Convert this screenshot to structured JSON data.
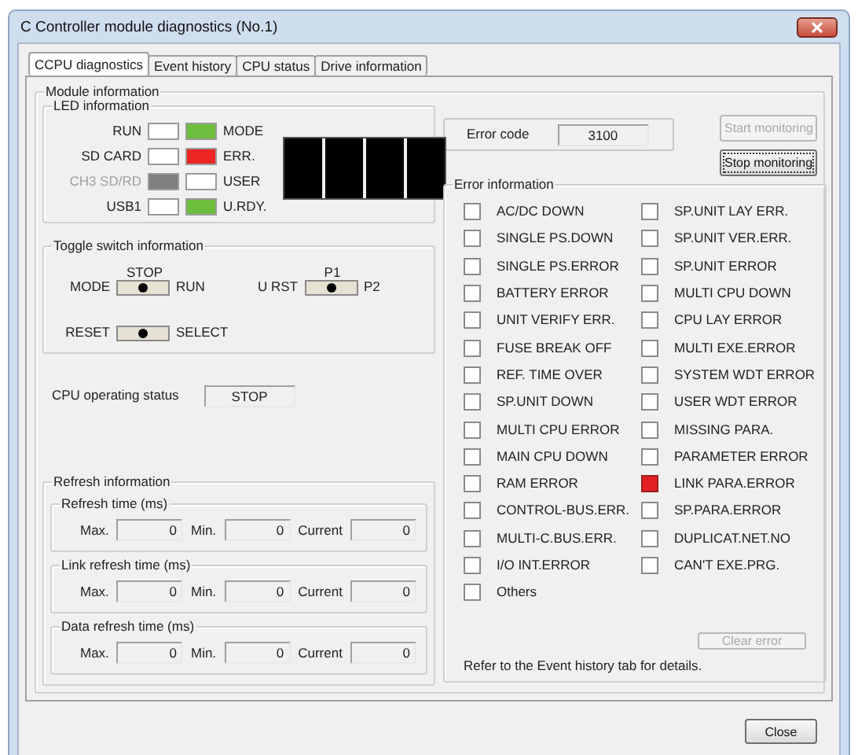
{
  "window": {
    "title": "C Controller module diagnostics (No.1)"
  },
  "tabs": [
    {
      "label": "CCPU diagnostics",
      "selected": true
    },
    {
      "label": "Event history",
      "selected": false
    },
    {
      "label": "CPU status",
      "selected": false
    },
    {
      "label": "Drive information",
      "selected": false
    }
  ],
  "module_information": {
    "title": "Module information",
    "led_information": {
      "title": "LED information",
      "leds": [
        {
          "label": "RUN",
          "color": "#ffffff",
          "disabled": false
        },
        {
          "label": "MODE",
          "color": "#6cbf3c",
          "disabled": false
        },
        {
          "label": "SD CARD",
          "color": "#ffffff",
          "disabled": false
        },
        {
          "label": "ERR.",
          "color": "#ee2525",
          "disabled": false
        },
        {
          "label": "CH3 SD/RD",
          "color": "#808080",
          "disabled": true
        },
        {
          "label": "USER",
          "color": "#ffffff",
          "disabled": false
        },
        {
          "label": "USB1",
          "color": "#ffffff",
          "disabled": false
        },
        {
          "label": "U.RDY.",
          "color": "#6cbf3c",
          "disabled": false
        }
      ]
    },
    "toggle_switch_information": {
      "title": "Toggle switch information",
      "switches": [
        {
          "label": "MODE",
          "top_label": "STOP",
          "right_label": "RUN",
          "level": 0.5
        },
        {
          "label": "U RST",
          "top_label": "P1",
          "right_label": "P2",
          "level": 0.5
        },
        {
          "label": "RESET",
          "right_label": "SELECT",
          "level": 0.5
        }
      ]
    },
    "cpu_operating_status": {
      "label": "CPU operating status",
      "value": "STOP"
    },
    "refresh_information": {
      "title": "Refresh information",
      "groups": [
        {
          "title": "Refresh time (ms)",
          "fields": [
            {
              "label": "Max.",
              "value": "0"
            },
            {
              "label": "Min.",
              "value": "0"
            },
            {
              "label": "Current",
              "value": "0"
            }
          ]
        },
        {
          "title": "Link refresh time (ms)",
          "fields": [
            {
              "label": "Max.",
              "value": "0"
            },
            {
              "label": "Min.",
              "value": "0"
            },
            {
              "label": "Current",
              "value": "0"
            }
          ]
        },
        {
          "title": "Data refresh time (ms)",
          "fields": [
            {
              "label": "Max.",
              "value": "0"
            },
            {
              "label": "Min.",
              "value": "0"
            },
            {
              "label": "Current",
              "value": "0"
            }
          ]
        }
      ]
    },
    "error_code": {
      "label": "Error code",
      "value": "3100"
    },
    "monitor_buttons": [
      {
        "label": "Start monitoring",
        "disabled": true
      },
      {
        "label": "Stop monitoring",
        "disabled": false
      }
    ],
    "error_information": {
      "title": "Error information",
      "columns": [
        [
          {
            "label": "AC/DC DOWN",
            "on": false
          },
          {
            "label": "SINGLE PS.DOWN",
            "on": false
          },
          {
            "label": "SINGLE PS.ERROR",
            "on": false
          },
          {
            "label": "BATTERY ERROR",
            "on": false
          },
          {
            "label": "UNIT VERIFY ERR.",
            "on": false
          },
          {
            "label": "FUSE BREAK OFF",
            "on": false
          },
          {
            "label": "REF. TIME OVER",
            "on": false
          },
          {
            "label": "SP.UNIT DOWN",
            "on": false
          },
          {
            "label": "MULTI CPU ERROR",
            "on": false
          },
          {
            "label": "MAIN CPU DOWN",
            "on": false
          },
          {
            "label": "RAM ERROR",
            "on": false
          },
          {
            "label": "CONTROL-BUS.ERR.",
            "on": false
          },
          {
            "label": "MULTI-C.BUS.ERR.",
            "on": false
          },
          {
            "label": "I/O INT.ERROR",
            "on": false
          },
          {
            "label": "Others",
            "on": false
          }
        ],
        [
          {
            "label": "SP.UNIT LAY ERR.",
            "on": false
          },
          {
            "label": "SP.UNIT VER.ERR.",
            "on": false
          },
          {
            "label": "SP.UNIT ERROR",
            "on": false
          },
          {
            "label": "MULTI CPU DOWN",
            "on": false
          },
          {
            "label": "CPU LAY ERROR",
            "on": false
          },
          {
            "label": "MULTI EXE.ERROR",
            "on": false
          },
          {
            "label": "SYSTEM WDT ERROR",
            "on": false
          },
          {
            "label": "USER WDT ERROR",
            "on": false
          },
          {
            "label": "MISSING PARA.",
            "on": false
          },
          {
            "label": "PARAMETER ERROR",
            "on": false
          },
          {
            "label": "LINK PARA.ERROR",
            "on": true
          },
          {
            "label": "SP.PARA.ERROR",
            "on": false
          },
          {
            "label": "DUPLICAT.NET.NO",
            "on": false
          },
          {
            "label": "CAN'T EXE.PRG.",
            "on": false
          }
        ]
      ],
      "clear_button": {
        "label": "Clear error",
        "disabled": true
      },
      "note": "Refer to the Event history tab for details."
    }
  },
  "close_button": {
    "label": "Close"
  }
}
